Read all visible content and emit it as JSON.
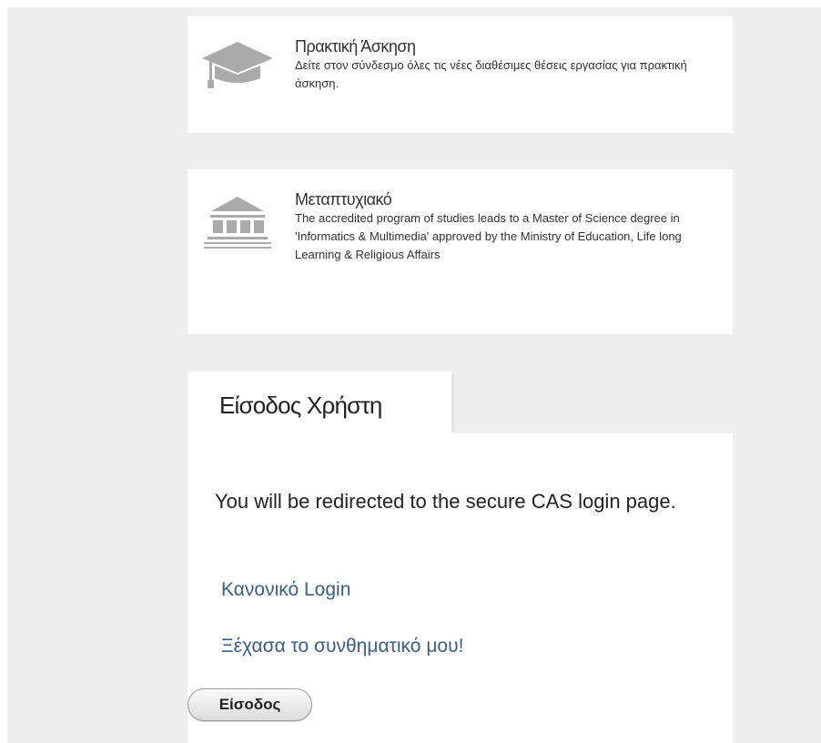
{
  "cards": [
    {
      "title": "Πρακτική Άσκηση",
      "description": "Δείτε στον σύνδεσμο όλες τις νέες διαθέσιμες θέσεις εργασίας για πρακτική άσκηση.",
      "icon": "graduation-cap-icon"
    },
    {
      "title": "Μεταπτυχιακό",
      "description": "The accredited program of studies leads to a Master of Science degree in 'Informatics & Multimedia' approved by the Ministry of Education, Life long Learning & Religious Affairs",
      "icon": "institution-building-icon"
    }
  ],
  "login": {
    "tab_label": "Είσοδος Χρήστη",
    "redirect_message": "You will be redirected to the secure CAS login page.",
    "normal_login_link": "Κανονικό Login",
    "forgot_password_link": "Ξέχασα το συνθηματικό μου!",
    "submit_label": "Είσοδος"
  },
  "colors": {
    "page_background": "#eeeeee",
    "card_background": "#ffffff",
    "link": "#3a5f84",
    "icon": "#aaaaaa"
  }
}
